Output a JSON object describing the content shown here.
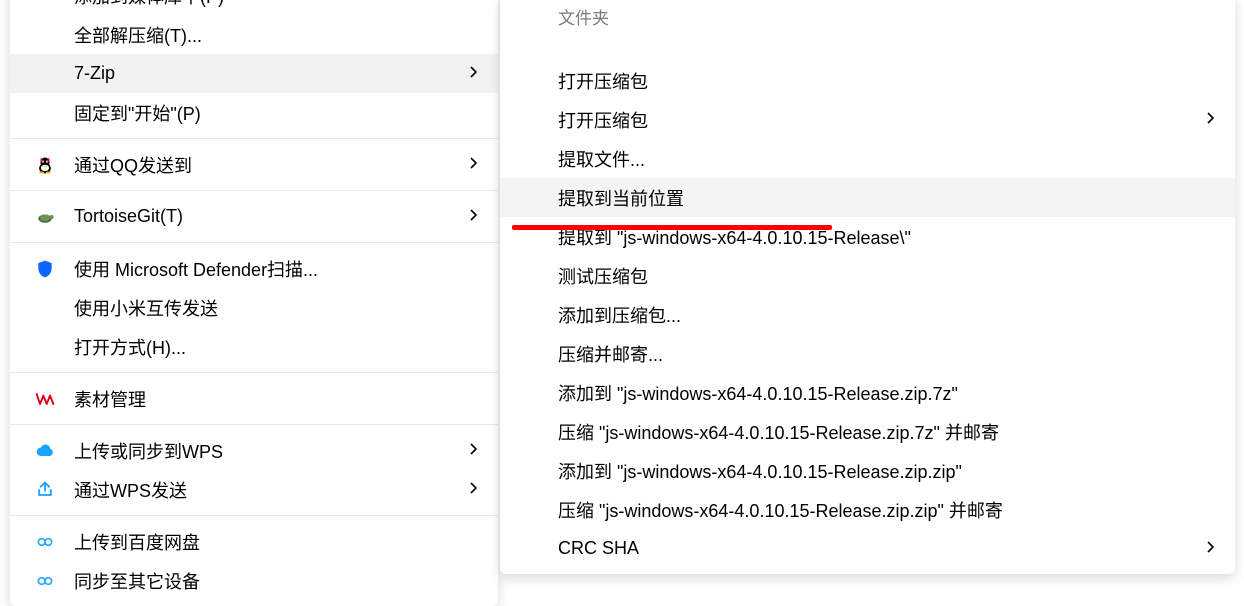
{
  "left_menu": {
    "items": [
      {
        "id": "add-library",
        "label": "添加到媒体库中(P)",
        "icon": null,
        "arrow": false
      },
      {
        "id": "extract-all",
        "label": "全部解压缩(T)...",
        "icon": null,
        "arrow": false
      },
      {
        "id": "7zip",
        "label": "7-Zip",
        "icon": null,
        "arrow": true,
        "hover": true
      },
      {
        "id": "pin-start",
        "label": "固定到\"开始\"(P)",
        "icon": null,
        "arrow": false
      },
      {
        "separator": true
      },
      {
        "id": "qq-send",
        "label": "通过QQ发送到",
        "icon": "qq",
        "arrow": true
      },
      {
        "separator": true
      },
      {
        "id": "tortoisegit",
        "label": "TortoiseGit(T)",
        "icon": "tortoise",
        "arrow": true
      },
      {
        "separator": true
      },
      {
        "id": "defender",
        "label": "使用 Microsoft Defender扫描...",
        "icon": "shield",
        "arrow": false
      },
      {
        "id": "xiaomi-send",
        "label": "使用小米互传发送",
        "icon": null,
        "arrow": false
      },
      {
        "id": "open-with",
        "label": "打开方式(H)...",
        "icon": null,
        "arrow": false
      },
      {
        "separator": true
      },
      {
        "id": "wps-asset",
        "label": "素材管理",
        "icon": "wps-red",
        "arrow": false
      },
      {
        "separator": true
      },
      {
        "id": "wps-upload",
        "label": "上传或同步到WPS",
        "icon": "cloud",
        "arrow": true
      },
      {
        "id": "wps-send",
        "label": "通过WPS发送",
        "icon": "share",
        "arrow": true
      },
      {
        "separator": true
      },
      {
        "id": "baidu-upload",
        "label": "上传到百度网盘",
        "icon": "link",
        "arrow": false
      },
      {
        "id": "baidu-sync",
        "label": "同步至其它设备",
        "icon": "link",
        "arrow": false
      }
    ]
  },
  "right_menu": {
    "title": "文件夹",
    "items": [
      {
        "id": "open-archive-1",
        "label": "打开压缩包",
        "arrow": false
      },
      {
        "id": "open-archive-2",
        "label": "打开压缩包",
        "arrow": true
      },
      {
        "id": "extract-files",
        "label": "提取文件...",
        "arrow": false
      },
      {
        "id": "extract-here",
        "label": "提取到当前位置",
        "arrow": false,
        "hover": true,
        "highlighted_by_redline": true
      },
      {
        "id": "extract-to",
        "label": "提取到 \"js-windows-x64-4.0.10.15-Release\\\"",
        "arrow": false
      },
      {
        "id": "test-archive",
        "label": "测试压缩包",
        "arrow": false
      },
      {
        "id": "add-archive",
        "label": "添加到压缩包...",
        "arrow": false
      },
      {
        "id": "compress-mail",
        "label": "压缩并邮寄...",
        "arrow": false
      },
      {
        "id": "add-7z",
        "label": "添加到 \"js-windows-x64-4.0.10.15-Release.zip.7z\"",
        "arrow": false
      },
      {
        "id": "compress-7z-mail",
        "label": "压缩 \"js-windows-x64-4.0.10.15-Release.zip.7z\" 并邮寄",
        "arrow": false
      },
      {
        "id": "add-zip",
        "label": "添加到 \"js-windows-x64-4.0.10.15-Release.zip.zip\"",
        "arrow": false
      },
      {
        "id": "compress-zip-mail",
        "label": "压缩 \"js-windows-x64-4.0.10.15-Release.zip.zip\" 并邮寄",
        "arrow": false
      },
      {
        "id": "crc-sha",
        "label": "CRC SHA",
        "arrow": true
      }
    ]
  }
}
